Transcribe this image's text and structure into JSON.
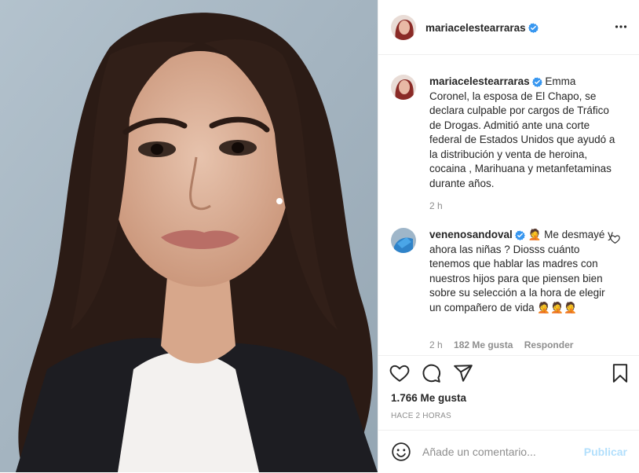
{
  "post": {
    "author": "mariacelestearraras",
    "caption": "Emma Coronel, la esposa de El Chapo, se declara culpable por cargos de Tráfico de Drogas. Admitió ante una corte federal de Estados Unidos que ayudó a la distribución y venta de heroina, cocaina , Marihuana y metanfetaminas durante años.",
    "caption_time": "2 h",
    "likes": "1.766 Me gusta",
    "posted": "HACE 2 HORAS"
  },
  "comments": [
    {
      "user": "venenosandoval",
      "text": "🤦 Me desmayé y ahora las niñas ? Diosss cuánto tenemos que hablar las madres con nuestros hijos para que piensen bien sobre su selección a la hora de elegir un compañero de vida 🤦🤦🤦",
      "time": "2 h",
      "likes": "182 Me gusta",
      "reply": "Responder"
    }
  ],
  "composer": {
    "placeholder": "Añade un comentario...",
    "publish": "Publicar"
  },
  "colors": {
    "verified": "#3897f0",
    "muted": "#8e8e8e",
    "publish_disabled": "#b2dffc"
  },
  "icons": [
    "verified-badge-icon",
    "more-options-icon",
    "heart-icon",
    "comment-icon",
    "share-icon",
    "bookmark-icon",
    "emoji-icon"
  ]
}
